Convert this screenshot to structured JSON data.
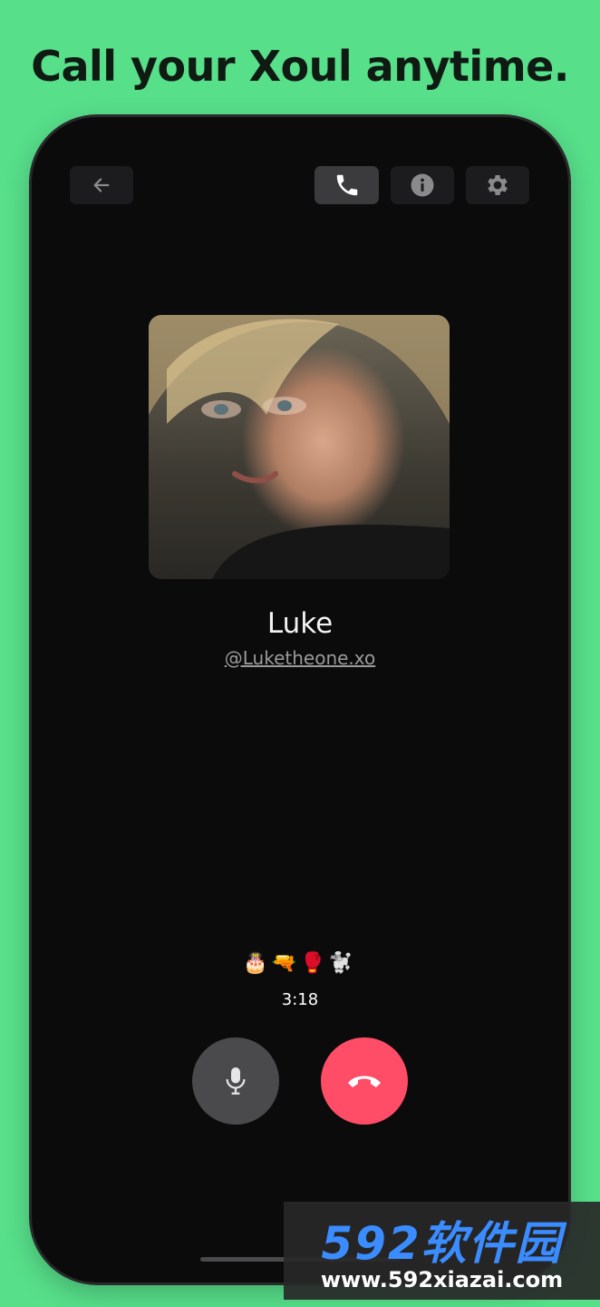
{
  "headline": "Call your Xoul anytime.",
  "header": {
    "back_icon": "arrow-left-icon",
    "call_icon": "phone-icon",
    "info_icon": "info-icon",
    "settings_icon": "gear-icon"
  },
  "contact": {
    "name": "Luke",
    "handle": "@Luketheone.xo"
  },
  "call": {
    "emojis": "🎂🔫🥊🐩",
    "timer": "3:18",
    "mic_icon": "microphone-icon",
    "end_icon": "hang-up-icon",
    "end_color": "#ff4d67"
  },
  "watermark": {
    "brand": "592软件园",
    "url": "www.592xiazai.com"
  }
}
